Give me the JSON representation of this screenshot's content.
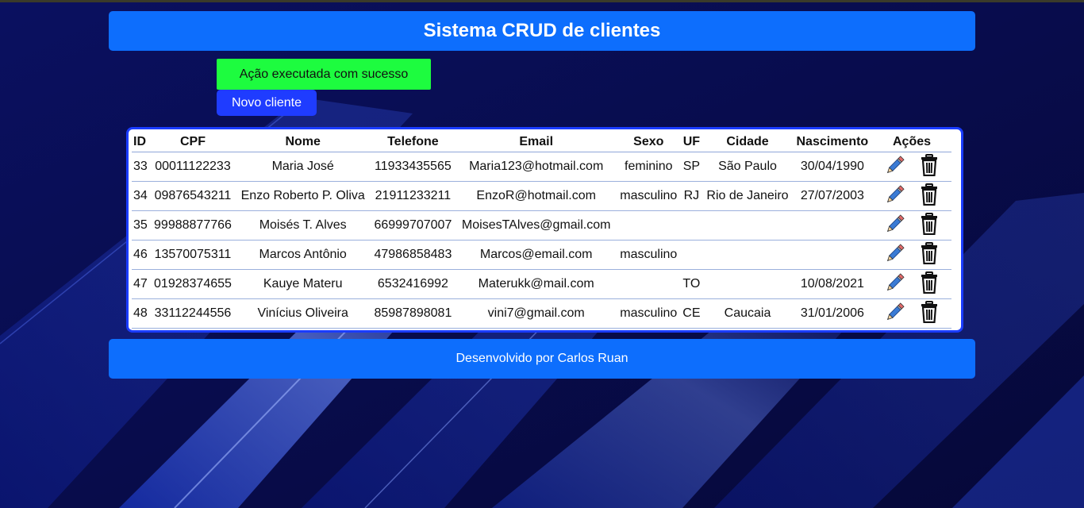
{
  "header": {
    "title": "Sistema CRUD de clientes"
  },
  "alert": {
    "message": "Ação executada com sucesso"
  },
  "actions": {
    "new_client_label": "Novo cliente"
  },
  "table": {
    "headers": [
      "ID",
      "CPF",
      "Nome",
      "Telefone",
      "Email",
      "Sexo",
      "UF",
      "Cidade",
      "Nascimento",
      "Ações"
    ],
    "rows": [
      {
        "id": "33",
        "cpf": "00011122233",
        "nome": "Maria José",
        "telefone": "11933435565",
        "email": "Maria123@hotmail.com",
        "sexo": "feminino",
        "uf": "SP",
        "cidade": "São Paulo",
        "nascimento": "30/04/1990"
      },
      {
        "id": "34",
        "cpf": "09876543211",
        "nome": "Enzo Roberto P. Oliva",
        "telefone": "21911233211",
        "email": "EnzoR@hotmail.com",
        "sexo": "masculino",
        "uf": "RJ",
        "cidade": "Rio de Janeiro",
        "nascimento": "27/07/2003"
      },
      {
        "id": "35",
        "cpf": "99988877766",
        "nome": "Moisés T. Alves",
        "telefone": "66999707007",
        "email": "MoisesTAlves@gmail.com",
        "sexo": "",
        "uf": "",
        "cidade": "",
        "nascimento": ""
      },
      {
        "id": "46",
        "cpf": "13570075311",
        "nome": "Marcos Antônio",
        "telefone": "47986858483",
        "email": "Marcos@email.com",
        "sexo": "masculino",
        "uf": "",
        "cidade": "",
        "nascimento": ""
      },
      {
        "id": "47",
        "cpf": "01928374655",
        "nome": "Kauye Materu",
        "telefone": "6532416992",
        "email": "Materukk@mail.com",
        "sexo": "",
        "uf": "TO",
        "cidade": "",
        "nascimento": "10/08/2021"
      },
      {
        "id": "48",
        "cpf": "33112244556",
        "nome": "Vinícius Oliveira",
        "telefone": "85987898081",
        "email": "vini7@gmail.com",
        "sexo": "masculino",
        "uf": "CE",
        "cidade": "Caucaia",
        "nascimento": "31/01/2006"
      }
    ]
  },
  "icons": {
    "edit": "pencil-icon",
    "delete": "trash-icon"
  },
  "footer": {
    "text": "Desenvolvido por Carlos Ruan"
  },
  "colors": {
    "background": "#070a44",
    "header": "#0d6efd",
    "alert_success": "#1dfc3f",
    "primary_button": "#1f3cff",
    "table_border": "#1a3cff"
  }
}
